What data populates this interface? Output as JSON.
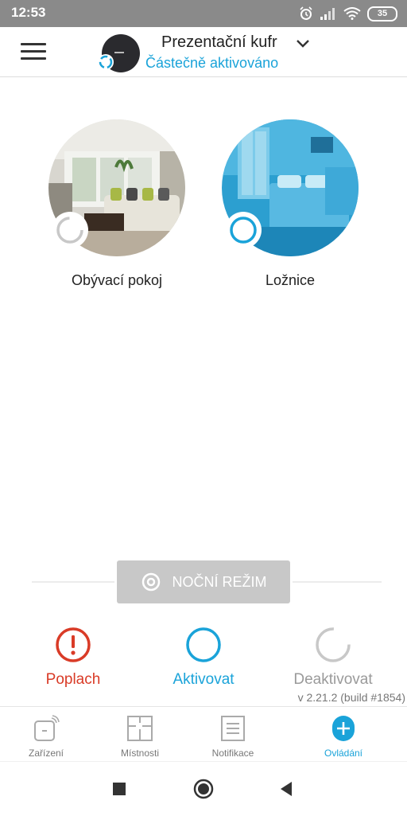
{
  "status_bar": {
    "time": "12:53",
    "battery": "35",
    "icons": [
      "alarm-icon",
      "signal-icon",
      "wifi-icon",
      "battery-icon"
    ]
  },
  "header": {
    "hub_name": "Prezentační kufr",
    "hub_status": "Částečně aktivováno",
    "menu_icon": "hamburger-menu-icon",
    "dropdown_icon": "chevron-down-icon"
  },
  "rooms": [
    {
      "name": "Obývací pokoj",
      "state": "deactivated"
    },
    {
      "name": "Ložnice",
      "state": "activated"
    }
  ],
  "night_mode": {
    "label": "NOČNÍ REŽIM"
  },
  "actions": {
    "alarm": {
      "label": "Poplach",
      "color": "#d93b27"
    },
    "arm": {
      "label": "Aktivovat",
      "color": "#1aa3d9"
    },
    "disarm": {
      "label": "Deaktivovat",
      "color": "#9a9a9a"
    }
  },
  "version": "v 2.21.2 (build #1854)",
  "bottom_nav": {
    "items": [
      {
        "label": "Zařízení",
        "icon": "devices-icon"
      },
      {
        "label": "Místnosti",
        "icon": "rooms-icon"
      },
      {
        "label": "Notifikace",
        "icon": "notifications-icon"
      },
      {
        "label": "Ovládání",
        "icon": "control-icon",
        "active": true
      }
    ]
  },
  "colors": {
    "accent": "#1aa3d9",
    "alarm": "#d93b27",
    "inactive": "#9a9a9a"
  }
}
